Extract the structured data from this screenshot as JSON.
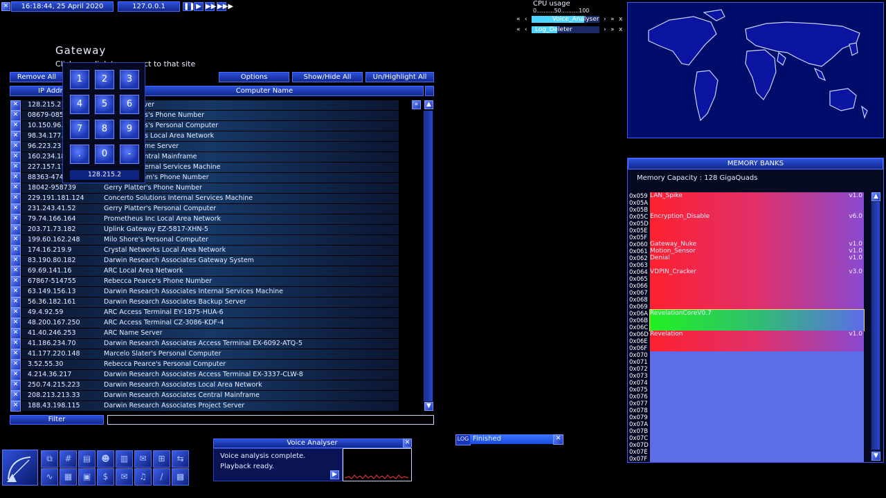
{
  "topbar": {
    "datetime": "16:18:44, 25 April 2020",
    "ip": "127.0.0.1",
    "close_icon": "x-icon"
  },
  "cpu": {
    "title": "CPU usage",
    "scale": "0..........50..........100",
    "processes": [
      {
        "name": "Voice_Analyser",
        "fill_fraction": 0.78
      },
      {
        "name": "Log_Deleter",
        "fill_fraction": 0.38
      }
    ]
  },
  "gateway": {
    "title": "Gateway",
    "subtitle": "Click on a link to connect to that site",
    "buttons": {
      "remove_all": "Remove All",
      "options": "Options",
      "show_hide": "Show/Hide All",
      "unhighlight": "Un/Highlight All"
    },
    "columns": {
      "ip": "IP Address",
      "name": "Computer Name"
    },
    "rows": [
      {
        "ip": "128.215.2",
        "name": "InterNIC Server"
      },
      {
        "ip": "08679-085",
        "name": "Felix Knowles's Phone Number"
      },
      {
        "ip": "10.150.96.3",
        "name": "Felix Knowles's Personal Computer"
      },
      {
        "ip": "98.34.177.",
        "name": "Felix Knowles Local Area Network"
      },
      {
        "ip": "96.223.23",
        "name": "Concerto Name Server"
      },
      {
        "ip": "160.234.18",
        "name": "Concerto Central Mainframe"
      },
      {
        "ip": "227.157.176",
        "name": "Concerto Internal Services Machine"
      },
      {
        "ip": "88363-474",
        "name": "Oliver Stolohm's Phone Number"
      },
      {
        "ip": "18042-958739",
        "name": "Gerry Platter's Phone Number"
      },
      {
        "ip": "229.191.181.124",
        "name": "Concerto Solutions Internal Services Machine"
      },
      {
        "ip": "231.243.41.52",
        "name": "Gerry Platter's Personal Computer"
      },
      {
        "ip": "79.74.166.164",
        "name": "Prometheus Inc Local Area Network"
      },
      {
        "ip": "203.71.73.182",
        "name": "Uplink Gateway EZ-5817-XHN-5"
      },
      {
        "ip": "199.60.162.248",
        "name": "Milo Shore's Personal Computer"
      },
      {
        "ip": "174.16.219.9",
        "name": "Crystal Networks Local Area Network"
      },
      {
        "ip": "83.190.80.182",
        "name": "Darwin Research Associates Gateway System"
      },
      {
        "ip": "69.69.141.16",
        "name": "ARC Local Area Network"
      },
      {
        "ip": "67867-514755",
        "name": "Rebecca Pearce's Phone Number"
      },
      {
        "ip": "63.149.156.13",
        "name": "Darwin Research Associates Internal Services Machine"
      },
      {
        "ip": "56.36.182.161",
        "name": "Darwin Research Associates Backup Server"
      },
      {
        "ip": "49.4.92.59",
        "name": "ARC Access Terminal EY-1875-HUA-6"
      },
      {
        "ip": "48.200.167.250",
        "name": "ARC Access Terminal CZ-3086-KDF-4"
      },
      {
        "ip": "41.40.246.253",
        "name": "ARC Name Server"
      },
      {
        "ip": "41.186.234.70",
        "name": "Darwin Research Associates Access Terminal EX-6092-ATQ-5"
      },
      {
        "ip": "41.177.220.148",
        "name": "Marcelo Slater's Personal Computer"
      },
      {
        "ip": "3.52.55.30",
        "name": "Rebecca Pearce's Personal Computer"
      },
      {
        "ip": "4.214.36.217",
        "name": "Darwin Research Associates Access Terminal EX-3337-CLW-8"
      },
      {
        "ip": "250.74.215.223",
        "name": "Darwin Research Associates Local Area Network"
      },
      {
        "ip": "208.213.213.33",
        "name": "Darwin Research Associates Central Mainframe"
      },
      {
        "ip": "188.43.198.115",
        "name": "Darwin Research Associates Project Server"
      }
    ],
    "filter_label": "Filter",
    "filter_value": ""
  },
  "keypad": {
    "keys": [
      "1",
      "2",
      "3",
      "4",
      "5",
      "6",
      "7",
      "8",
      "9",
      ".",
      "0",
      "-"
    ],
    "display": "128.215.2"
  },
  "memory": {
    "title": "MEMORY BANKS",
    "capacity": "Memory Capacity : 128 GigaQuads",
    "addresses": [
      "0x059",
      "0x05A",
      "0x05B",
      "0x05C",
      "0x05D",
      "0x05E",
      "0x05F",
      "0x060",
      "0x061",
      "0x062",
      "0x063",
      "0x064",
      "0x065",
      "0x066",
      "0x067",
      "0x068",
      "0x069",
      "0x06A",
      "0x06B",
      "0x06C",
      "0x06D",
      "0x06E",
      "0x06F",
      "0x070",
      "0x071",
      "0x072",
      "0x073",
      "0x074",
      "0x075",
      "0x076",
      "0x077",
      "0x078",
      "0x079",
      "0x07A",
      "0x07B",
      "0x07C",
      "0x07D",
      "0x07E",
      "0x07F"
    ],
    "segments": [
      {
        "name": "LAN_Spike",
        "version": "v1.0",
        "start": 0,
        "length": 3,
        "kind": "red"
      },
      {
        "name": "Encryption_Disable",
        "version": "v6.0",
        "start": 3,
        "length": 4,
        "kind": "red"
      },
      {
        "name": "Gateway_Nuke",
        "version": "v1.0",
        "start": 7,
        "length": 1,
        "kind": "red"
      },
      {
        "name": "Motion_Sensor",
        "version": "v1.0",
        "start": 8,
        "length": 1,
        "kind": "red"
      },
      {
        "name": "Denial",
        "version": "v1.0",
        "start": 9,
        "length": 2,
        "kind": "red"
      },
      {
        "name": "VDPIN_Cracker",
        "version": "v3.0",
        "start": 11,
        "length": 6,
        "kind": "red"
      },
      {
        "name": "RevelationCoreV0.7",
        "version": "",
        "start": 17,
        "length": 3,
        "kind": "green"
      },
      {
        "name": "Revelation",
        "version": "v1.0",
        "start": 20,
        "length": 3,
        "kind": "red"
      }
    ]
  },
  "voice_analyser": {
    "title": "Voice Analyser",
    "line1": "Voice analysis complete.",
    "line2": "Playback ready."
  },
  "log": {
    "label": "LOG",
    "status": "Finished"
  },
  "toolbar_icons": [
    "window-icon",
    "hash-icon",
    "book-icon",
    "person-icon",
    "notes-icon",
    "mail-icon",
    "network-icon",
    "arrows-icon",
    "wave-icon",
    "doc-icon",
    "disk-icon",
    "dollar-icon",
    "envelope-icon",
    "music-icon",
    "slash-icon",
    "server-icon"
  ]
}
